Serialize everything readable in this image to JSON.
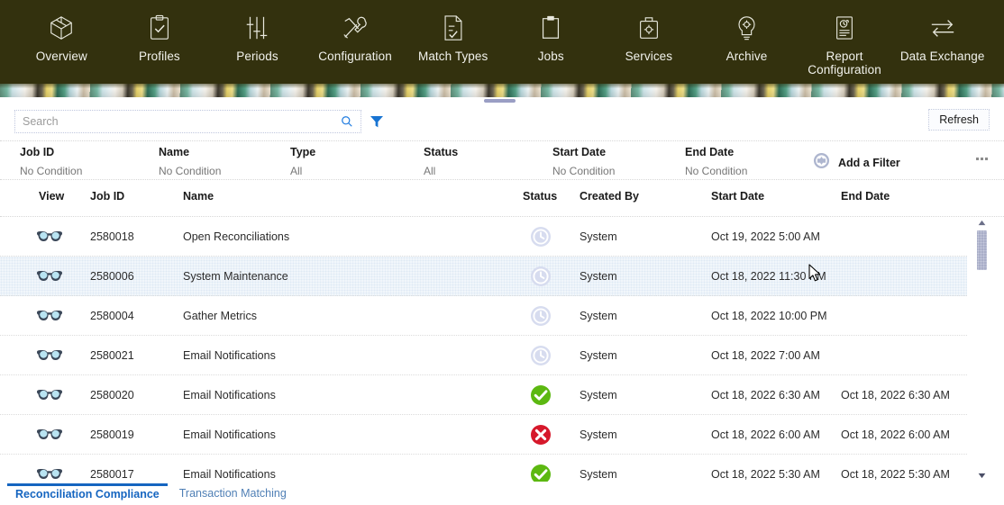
{
  "topnav": {
    "items": [
      {
        "label": "Overview",
        "icon": "cube-icon"
      },
      {
        "label": "Profiles",
        "icon": "clipboard-check-icon"
      },
      {
        "label": "Periods",
        "icon": "sliders-icon"
      },
      {
        "label": "Configuration",
        "icon": "tools-icon"
      },
      {
        "label": "Match Types",
        "icon": "document-check-icon"
      },
      {
        "label": "Jobs",
        "icon": "clipboard-icon"
      },
      {
        "label": "Services",
        "icon": "toolbox-gear-icon"
      },
      {
        "label": "Archive",
        "icon": "lightbulb-gear-icon"
      },
      {
        "label": "Report\nConfiguration",
        "icon": "report-clock-icon"
      },
      {
        "label": "Data Exchange",
        "icon": "exchange-arrows-icon"
      }
    ]
  },
  "toolbar": {
    "search_placeholder": "Search",
    "search_value": "",
    "refresh_label": "Refresh"
  },
  "filter_bar": {
    "columns": [
      {
        "title": "Job ID",
        "value": "No Condition"
      },
      {
        "title": "Name",
        "value": "No Condition"
      },
      {
        "title": "Type",
        "value": "All"
      },
      {
        "title": "Status",
        "value": "All"
      },
      {
        "title": "Start Date",
        "value": "No Condition"
      },
      {
        "title": "End Date",
        "value": "No Condition"
      }
    ],
    "add_filter_label": "Add a Filter"
  },
  "table": {
    "headers": [
      "View",
      "Job ID",
      "Name",
      "Status",
      "Created By",
      "Start Date",
      "End Date"
    ],
    "rows": [
      {
        "view": "glasses-icon",
        "job_id": "2580018",
        "name": "Open Reconciliations",
        "status": "pending",
        "created_by": "System",
        "start_date": "Oct 19, 2022 5:00 AM",
        "end_date": ""
      },
      {
        "view": "glasses-icon",
        "job_id": "2580006",
        "name": "System Maintenance",
        "status": "pending",
        "created_by": "System",
        "start_date": "Oct 18, 2022 11:30 PM",
        "end_date": ""
      },
      {
        "view": "glasses-icon",
        "job_id": "2580004",
        "name": "Gather Metrics",
        "status": "pending",
        "created_by": "System",
        "start_date": "Oct 18, 2022 10:00 PM",
        "end_date": ""
      },
      {
        "view": "glasses-icon",
        "job_id": "2580021",
        "name": "Email Notifications",
        "status": "pending",
        "created_by": "System",
        "start_date": "Oct 18, 2022 7:00 AM",
        "end_date": ""
      },
      {
        "view": "glasses-icon",
        "job_id": "2580020",
        "name": "Email Notifications",
        "status": "success",
        "created_by": "System",
        "start_date": "Oct 18, 2022 6:30 AM",
        "end_date": "Oct 18, 2022 6:30 AM"
      },
      {
        "view": "glasses-icon",
        "job_id": "2580019",
        "name": "Email Notifications",
        "status": "error",
        "created_by": "System",
        "start_date": "Oct 18, 2022 6:00 AM",
        "end_date": "Oct 18, 2022 6:00 AM"
      },
      {
        "view": "glasses-icon",
        "job_id": "2580017",
        "name": "Email Notifications",
        "status": "success",
        "created_by": "System",
        "start_date": "Oct 18, 2022 5:30 AM",
        "end_date": "Oct 18, 2022 5:30 AM"
      }
    ]
  },
  "bottom_tabs": [
    {
      "label": "Reconciliation Compliance",
      "active": true
    },
    {
      "label": "Transaction Matching",
      "active": false
    }
  ],
  "colors": {
    "nav_background": "#33310e",
    "accent_blue": "#1565c0",
    "status_success": "#4caf1e",
    "status_error": "#d32030",
    "status_pending": "#c9cfe8",
    "row_highlight": "#f1f6fb"
  }
}
